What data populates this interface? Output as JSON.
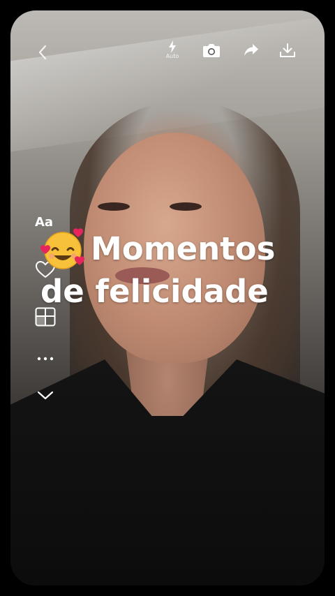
{
  "toolbar": {
    "flash_label": "Auto"
  },
  "side": {
    "text_tool_label": "Aa"
  },
  "caption": {
    "line1": "Momentos",
    "line2": "de felicidade",
    "emoji": "smiling-face-with-hearts"
  },
  "icons": {
    "back": "chevron-left-icon",
    "flash": "flash-icon",
    "camera": "camera-icon",
    "share": "share-icon",
    "download": "download-icon",
    "like": "heart-icon",
    "layout": "layout-icon",
    "more": "more-icon",
    "collapse": "chevron-down-icon"
  },
  "colors": {
    "background": "#000000",
    "text": "#ffffff"
  }
}
